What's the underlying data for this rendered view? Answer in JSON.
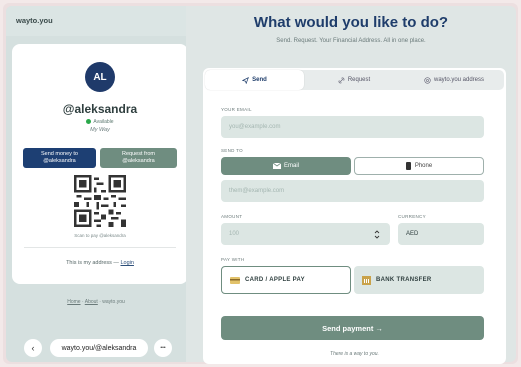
{
  "brand": "wayto.you",
  "profile": {
    "initials": "AL",
    "handle": "@aleksandra",
    "status": "Available",
    "tagline": "My Way",
    "send_line1": "Send money to",
    "send_line2": "@aleksandra",
    "request_line1": "Request from",
    "request_line2": "@aleksandra",
    "scan_text": "Scan to pay @aleksandra",
    "address_text": "This is my address —",
    "login_text": "Login"
  },
  "footer": {
    "home": "Home",
    "sep": "·",
    "about": "About",
    "domain": "wayto.you"
  },
  "urlbar": {
    "back": "‹",
    "url": "wayto.you/@aleksandra",
    "more": "•••"
  },
  "header": {
    "title": "What would you like to do?",
    "subtitle": "Send. Request. Your Financial Address. All in one place."
  },
  "tabs": [
    "Send",
    "Request",
    "wayto.you address"
  ],
  "form": {
    "email_label": "YOUR EMAIL",
    "email_placeholder": "you@example.com",
    "sendto_label": "SEND TO",
    "opt_email": "Email",
    "opt_phone": "Phone",
    "recipient_placeholder": "them@example.com",
    "amount_label": "AMOUNT",
    "amount_value": "100",
    "currency_label": "CURRENCY",
    "currency_value": "AED",
    "paywith_label": "PAY WITH",
    "pay_card": "CARD / APPLE PAY",
    "pay_bank": "BANK TRANSFER",
    "submit": "Send payment →",
    "footnote": "There is a way to you."
  },
  "colors": {
    "accent": "#6f8d80",
    "navy": "#1d3f73"
  }
}
